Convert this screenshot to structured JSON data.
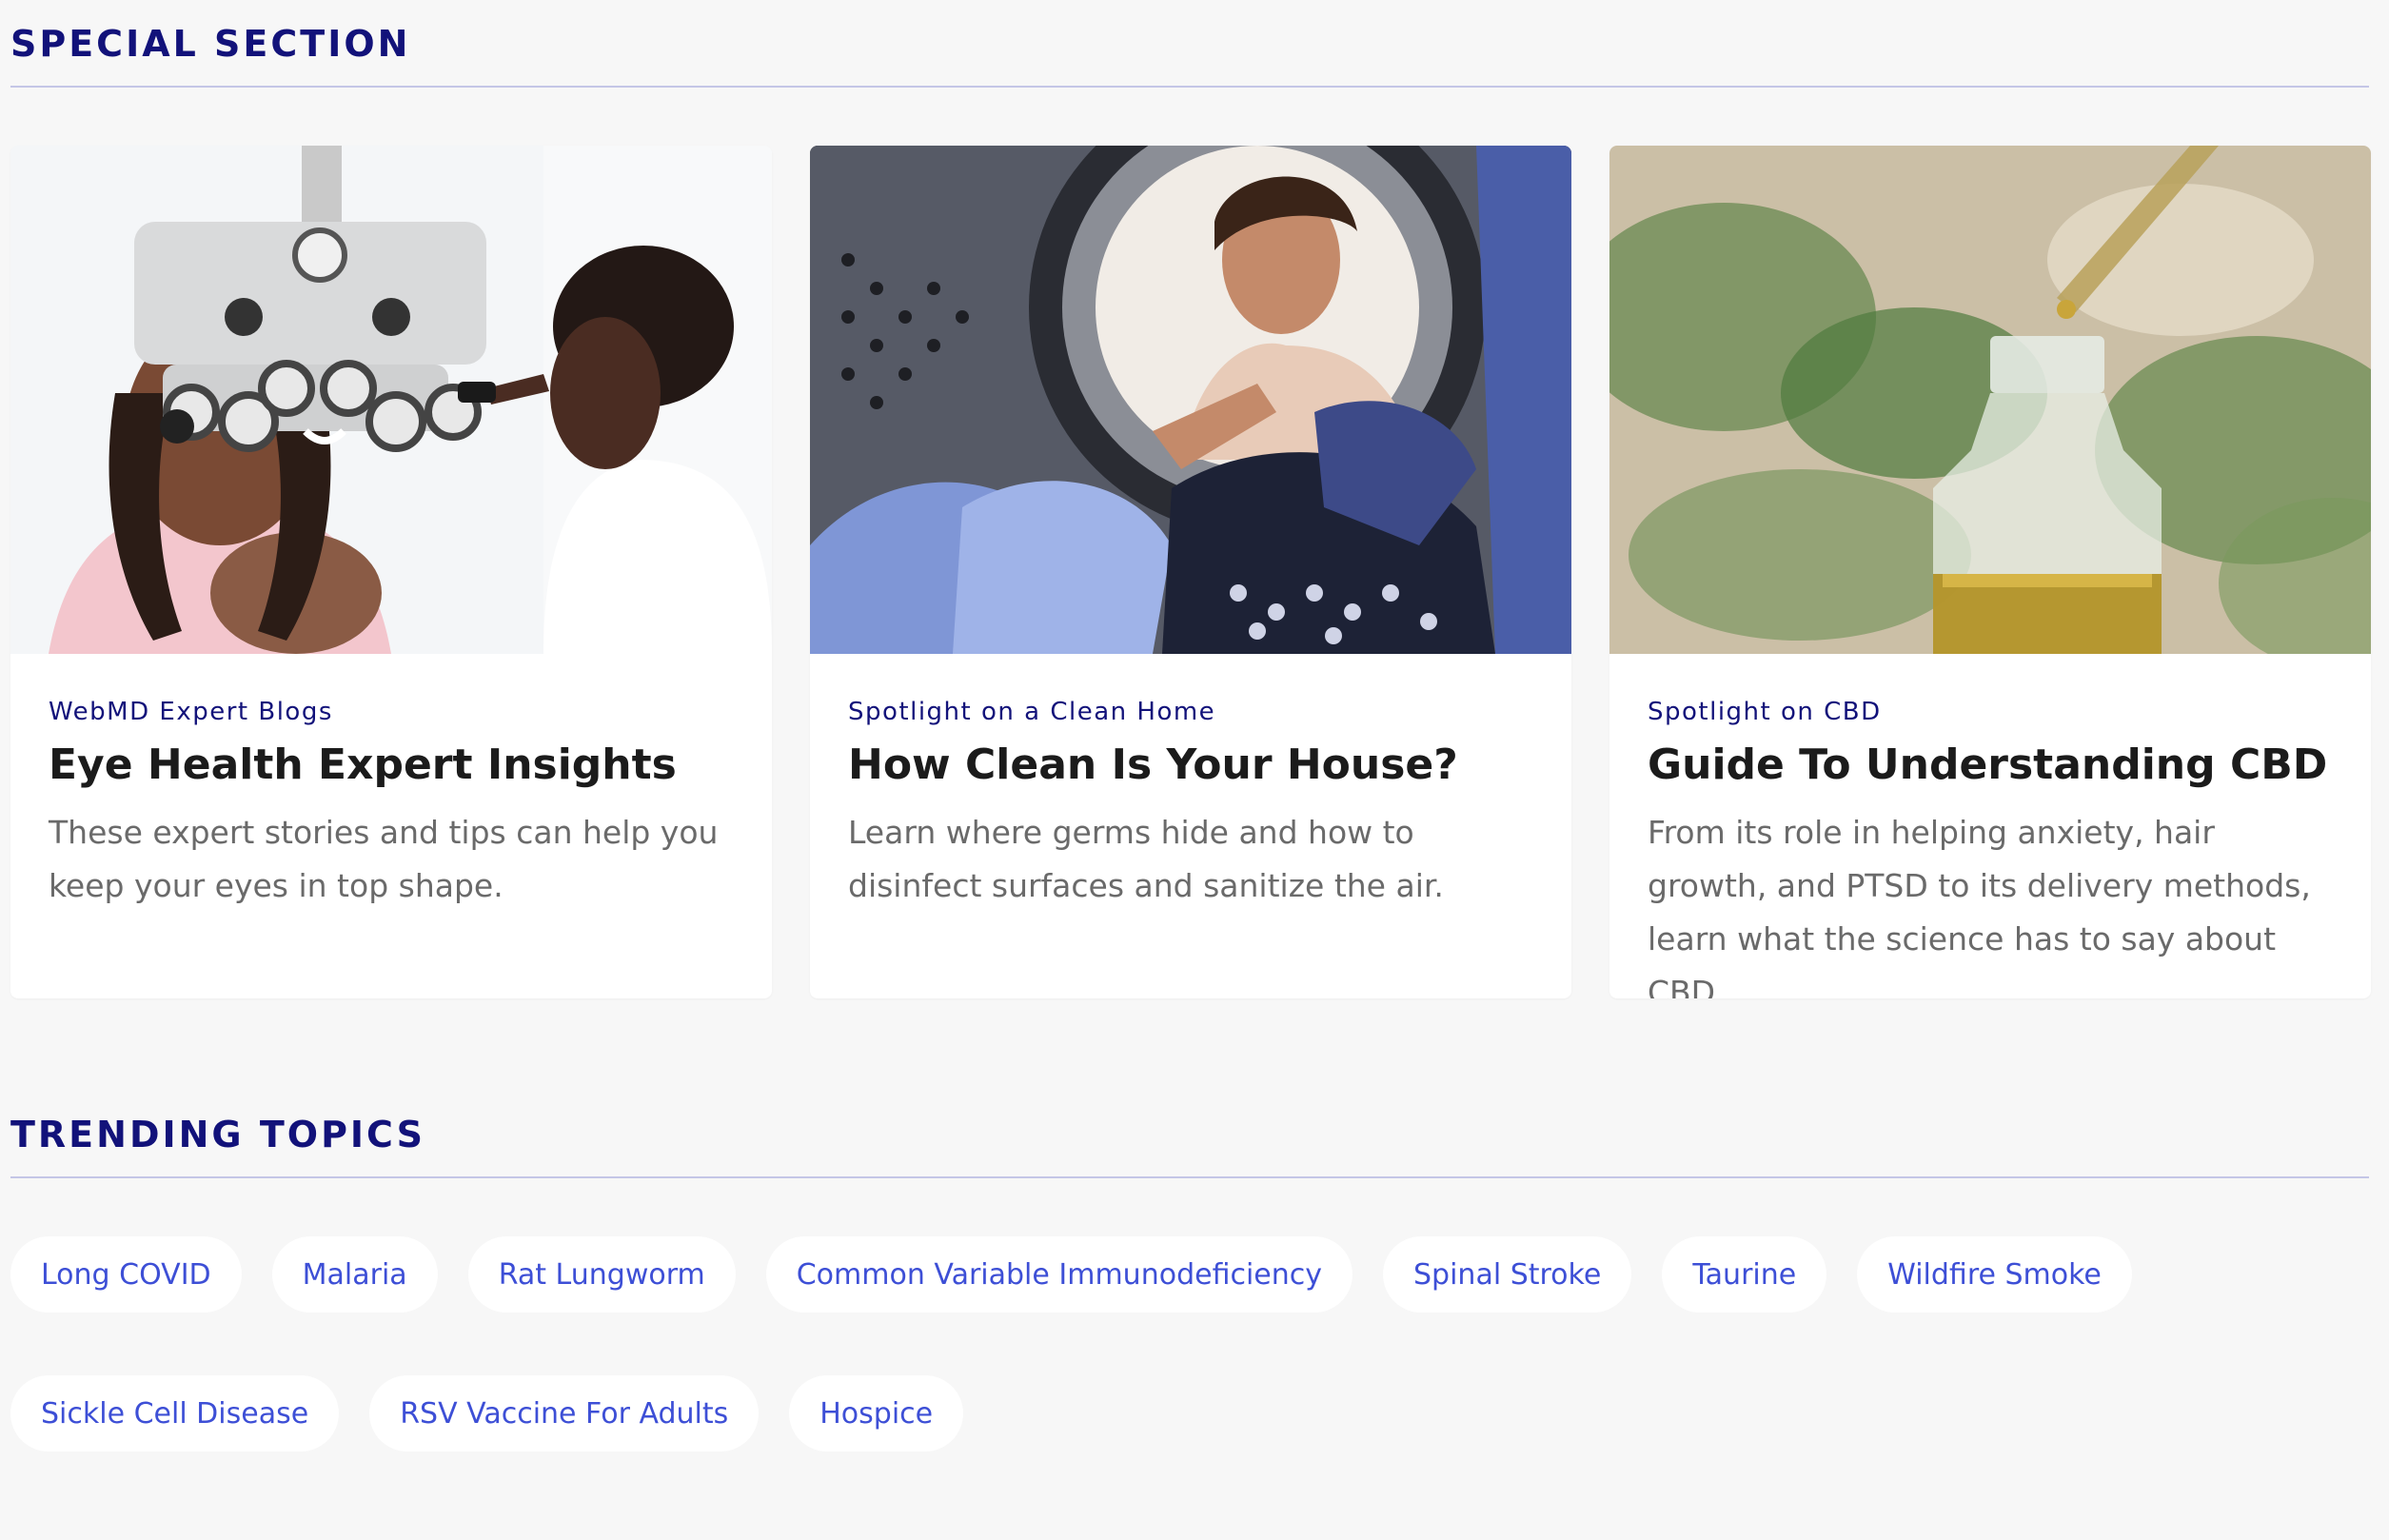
{
  "special_section": {
    "title": "SPECIAL SECTION",
    "cards": [
      {
        "kicker": "WebMD Expert Blogs",
        "title": "Eye Health Expert Insights",
        "description": "These expert stories and tips can help you keep your eyes in top shape.",
        "image_icon": "eye-exam-photo"
      },
      {
        "kicker": "Spotlight on a Clean Home",
        "title": "How Clean Is Your House?",
        "description": "Learn where germs hide and how to disinfect surfaces and sanitize the air.",
        "image_icon": "laundry-washer-photo"
      },
      {
        "kicker": "Spotlight on CBD",
        "title": "Guide To Understanding CBD",
        "description": "From its role in helping anxiety, hair growth, and PTSD to its delivery methods, learn what the science has to say about CBD.",
        "image_icon": "cbd-oil-bottle-photo"
      }
    ]
  },
  "trending_topics": {
    "title": "TRENDING TOPICS",
    "topics": [
      "Long COVID",
      "Malaria",
      "Rat Lungworm",
      "Common Variable Immunodeficiency",
      "Spinal Stroke",
      "Taurine",
      "Wildfire Smoke",
      "Sickle Cell Disease",
      "RSV Vaccine For Adults",
      "Hospice"
    ]
  },
  "colors": {
    "heading": "#12127a",
    "divider": "#c4c6e6",
    "chip_text": "#3d4fd6",
    "background": "#f7f7f7",
    "card_background": "#ffffff"
  }
}
